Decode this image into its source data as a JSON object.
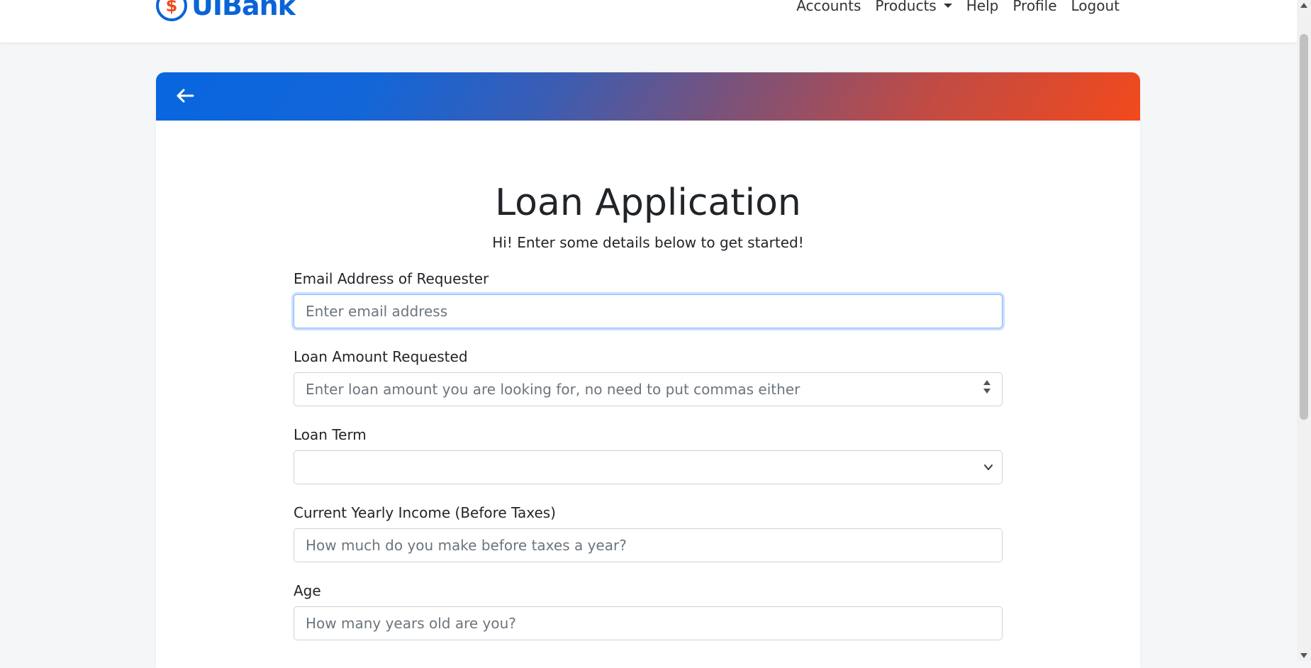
{
  "navbar": {
    "brand_icon": "dollar-badge-icon",
    "brand_icon_glyph": "$",
    "brand_text": "UIBank",
    "links": {
      "accounts": "Accounts",
      "products": "Products",
      "help": "Help",
      "profile": "Profile",
      "logout": "Logout"
    }
  },
  "header": {
    "back_icon": "arrow-left-icon",
    "gradient_start": "#0866e0",
    "gradient_end": "#f24a1c"
  },
  "main": {
    "title": "Loan Application",
    "subtitle": "Hi! Enter some details below to get started!"
  },
  "form": {
    "email": {
      "label": "Email Address of Requester",
      "placeholder": "Enter email address"
    },
    "amount": {
      "label": "Loan Amount Requested",
      "placeholder": "Enter loan amount you are looking for, no need to put commas either"
    },
    "term": {
      "label": "Loan Term",
      "selected": ""
    },
    "income": {
      "label": "Current Yearly Income (Before Taxes)",
      "placeholder": "How much do you make before taxes a year?"
    },
    "age": {
      "label": "Age",
      "placeholder": "How many years old are you?"
    }
  },
  "colors": {
    "brand_blue": "#0a64d8",
    "brand_orange": "#f04a1e"
  }
}
